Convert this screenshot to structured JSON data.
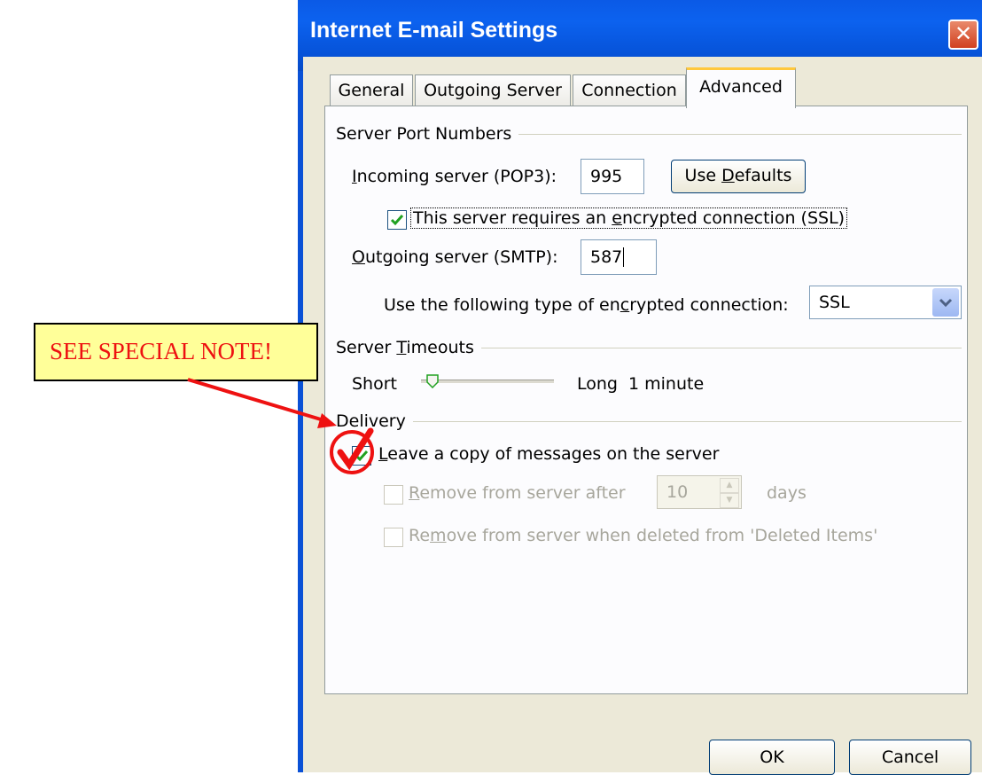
{
  "doc_text": "e op... ng ...) ... y",
  "dialog": {
    "title": "Internet E-mail Settings",
    "close_label": "✕"
  },
  "tabs": [
    {
      "label": "General",
      "active": false
    },
    {
      "label": "Outgoing Server",
      "active": false
    },
    {
      "label": "Connection",
      "active": false
    },
    {
      "label": "Advanced",
      "active": true
    }
  ],
  "server_port_numbers": {
    "group_label": "Server Port Numbers",
    "incoming_label_pre": "",
    "incoming_label_ul": "I",
    "incoming_label_post": "ncoming server (POP3):",
    "incoming_value": "995",
    "use_defaults_pre": "Use ",
    "use_defaults_ul": "D",
    "use_defaults_post": "efaults",
    "ssl_check_label_pre": "This server requires an ",
    "ssl_check_label_ul": "e",
    "ssl_check_label_post": "ncrypted connection (SSL)",
    "ssl_checked": true,
    "outgoing_label_ul": "O",
    "outgoing_label_post": "utgoing server (SMTP):",
    "outgoing_value": "587",
    "encryption_label_pre": "Use the following type of en",
    "encryption_label_ul": "c",
    "encryption_label_post": "rypted connection:",
    "encryption_value": "SSL"
  },
  "server_timeouts": {
    "group_label_pre": "Server ",
    "group_label_ul": "T",
    "group_label_post": "imeouts",
    "short_label": "Short",
    "long_label": "Long",
    "timeout_value": "1 minute",
    "slider_fraction": 0.0
  },
  "delivery": {
    "group_label": "Delivery",
    "leave_copy_ul": "L",
    "leave_copy_post": "eave a copy of messages on the server",
    "leave_copy_checked": true,
    "remove_after_ul": "R",
    "remove_after_post": "emove from server after",
    "remove_after_days": "10",
    "days_label": "days",
    "remove_deleted_pre": "Re",
    "remove_deleted_ul": "m",
    "remove_deleted_post": "ove from server when deleted from 'Deleted Items'"
  },
  "footer": {
    "ok_label": "OK",
    "cancel_label": "Cancel"
  },
  "callout": {
    "text": "SEE SPECIAL NOTE!"
  },
  "colors": {
    "titlebar": "#0a51d6",
    "callout_bg": "#ffff99",
    "callout_text": "#ee1111",
    "annotation_red": "#ee1111",
    "check_green": "#21a121"
  }
}
